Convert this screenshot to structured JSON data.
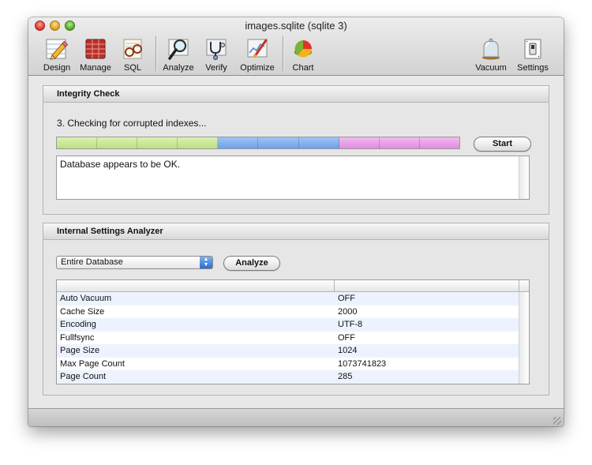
{
  "window": {
    "title": "images.sqlite (sqlite 3)"
  },
  "toolbar": {
    "items": [
      {
        "label": "Design",
        "icon": "pencil-ruler-icon"
      },
      {
        "label": "Manage",
        "icon": "table-grid-icon"
      },
      {
        "label": "SQL",
        "icon": "glasses-icon"
      },
      {
        "label": "Analyze",
        "icon": "magnifier-icon"
      },
      {
        "label": "Verify",
        "icon": "stethoscope-icon"
      },
      {
        "label": "Optimize",
        "icon": "chart-brush-icon"
      },
      {
        "label": "Chart",
        "icon": "pie-chart-icon"
      },
      {
        "label": "Vacuum",
        "icon": "bell-jar-icon"
      },
      {
        "label": "Settings",
        "icon": "switch-icon"
      }
    ]
  },
  "integrity": {
    "title": "Integrity Check",
    "status": "3. Checking for corrupted indexes...",
    "start_label": "Start",
    "result": "Database appears to be OK.",
    "colors": {
      "green": "#c9e896",
      "blue": "#84aeee",
      "pink": "#e9a2e6"
    }
  },
  "analyzer": {
    "title": "Internal Settings Analyzer",
    "scope_selected": "Entire Database",
    "analyze_label": "Analyze",
    "rows": [
      {
        "name": "Auto Vacuum",
        "value": "OFF"
      },
      {
        "name": "Cache Size",
        "value": "2000"
      },
      {
        "name": "Encoding",
        "value": "UTF-8"
      },
      {
        "name": "Fullfsync",
        "value": "OFF"
      },
      {
        "name": "Page Size",
        "value": "1024"
      },
      {
        "name": "Max Page Count",
        "value": "1073741823"
      },
      {
        "name": "Page Count",
        "value": "285"
      }
    ]
  }
}
